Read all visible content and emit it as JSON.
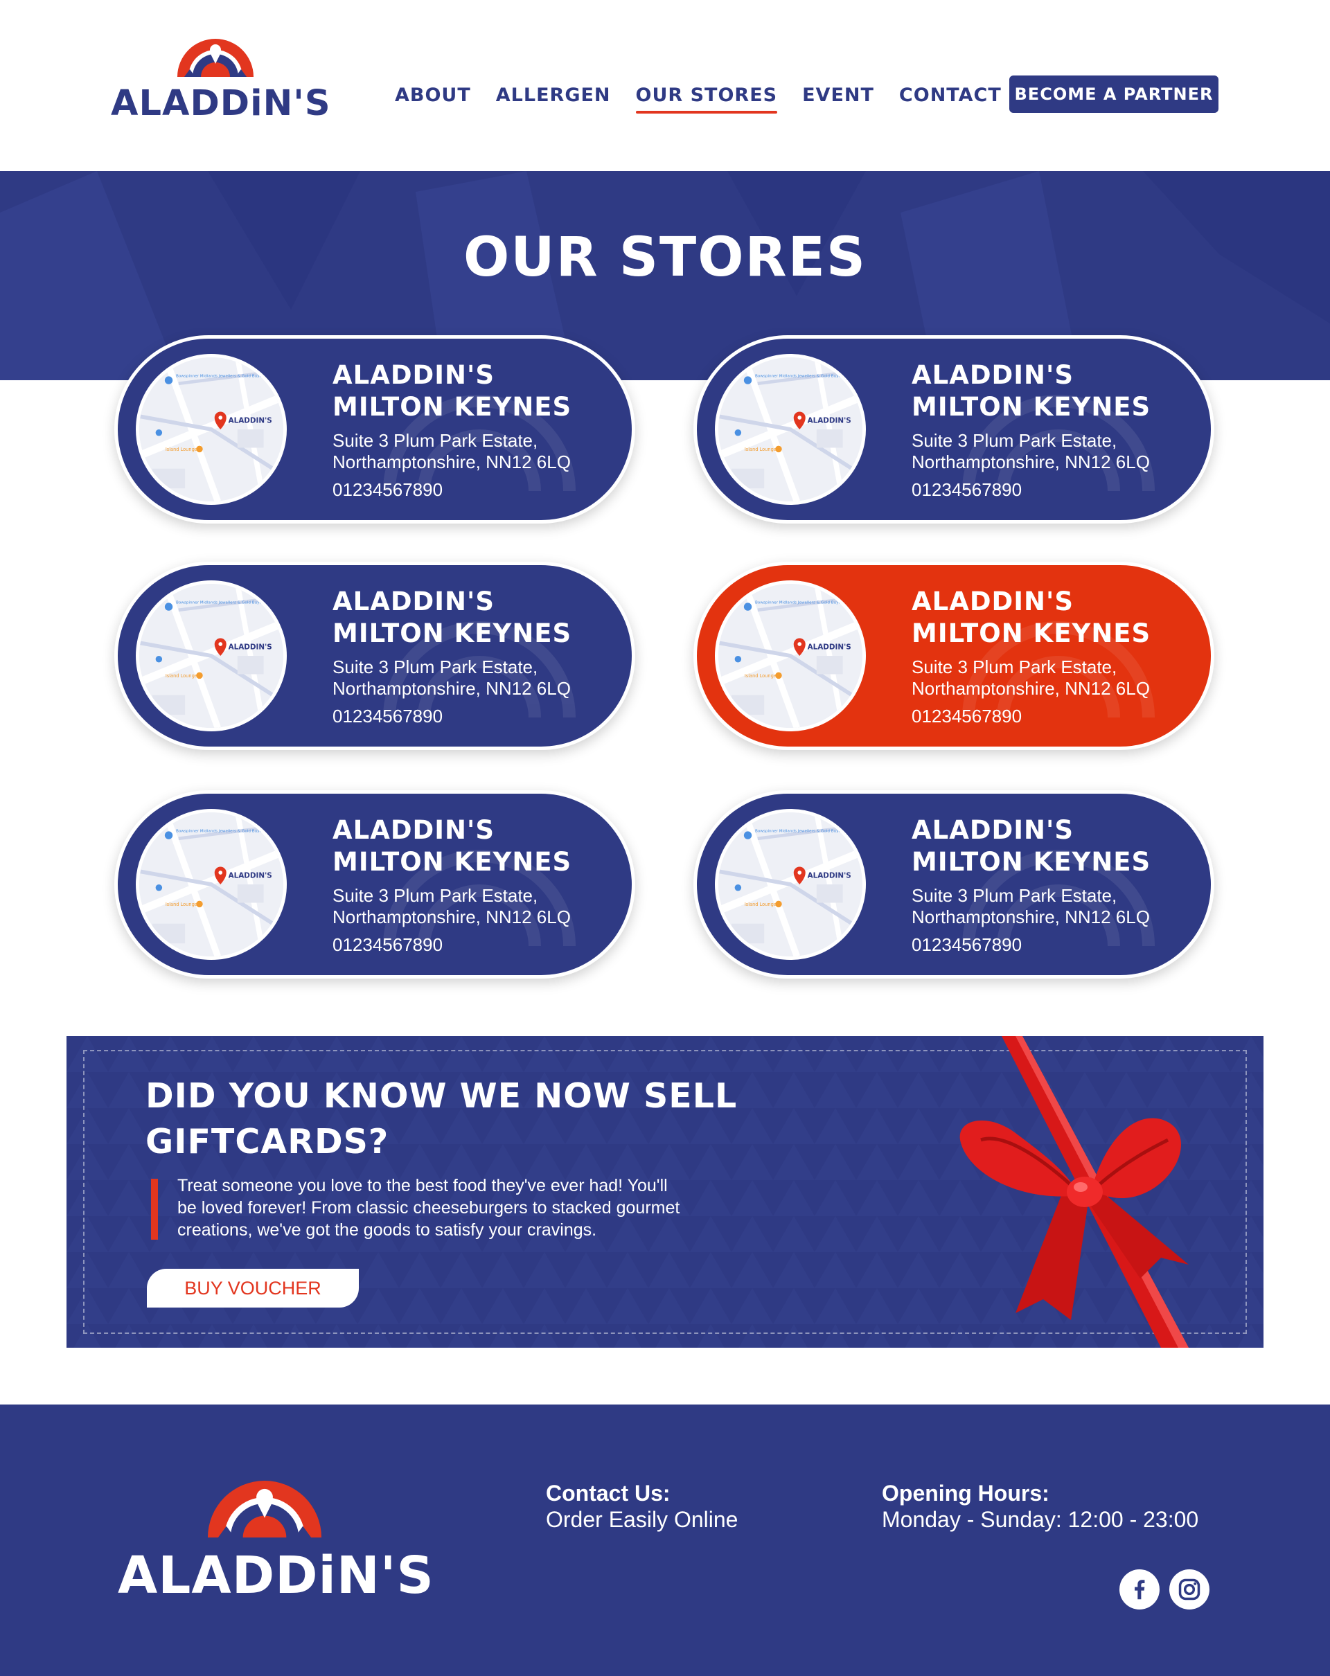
{
  "brand": {
    "name": "ALADDiN'S"
  },
  "nav": {
    "items": [
      "ABOUT",
      "ALLERGEN",
      "OUR STORES",
      "EVENT",
      "CONTACT US"
    ],
    "active": "OUR STORES",
    "cta": "BECOME A PARTNER"
  },
  "hero": {
    "title": "OUR STORES"
  },
  "stores": [
    {
      "name_line1": "ALADDIN'S",
      "name_line2": "MILTON KEYNES",
      "address_line1": "Suite 3 Plum Park Estate,",
      "address_line2": "Northamptonshire, NN12 6LQ",
      "phone": "01234567890",
      "map_label": "ALADDIN'S",
      "map_place1": "Bowspinner Midlands Jewellers & Gold Buyers",
      "map_place2": "Island Lounge",
      "highlighted": false
    },
    {
      "name_line1": "ALADDIN'S",
      "name_line2": "MILTON KEYNES",
      "address_line1": "Suite 3 Plum Park Estate,",
      "address_line2": "Northamptonshire, NN12 6LQ",
      "phone": "01234567890",
      "map_label": "ALADDIN'S",
      "map_place1": "Bowspinner Midlands Jewellers & Gold Buyers",
      "map_place2": "Island Lounge",
      "highlighted": false
    },
    {
      "name_line1": "ALADDIN'S",
      "name_line2": "MILTON KEYNES",
      "address_line1": "Suite 3 Plum Park Estate,",
      "address_line2": "Northamptonshire, NN12 6LQ",
      "phone": "01234567890",
      "map_label": "ALADDIN'S",
      "map_place1": "Bowspinner Midlands Jewellers & Gold Buyers",
      "map_place2": "Island Lounge",
      "highlighted": false
    },
    {
      "name_line1": "ALADDIN'S",
      "name_line2": "MILTON KEYNES",
      "address_line1": "Suite 3 Plum Park Estate,",
      "address_line2": "Northamptonshire, NN12 6LQ",
      "phone": "01234567890",
      "map_label": "ALADDIN'S",
      "map_place1": "Bowspinner Midlands Jewellers & Gold Buyers",
      "map_place2": "Island Lounge",
      "highlighted": true
    },
    {
      "name_line1": "ALADDIN'S",
      "name_line2": "MILTON KEYNES",
      "address_line1": "Suite 3 Plum Park Estate,",
      "address_line2": "Northamptonshire, NN12 6LQ",
      "phone": "01234567890",
      "map_label": "ALADDIN'S",
      "map_place1": "Bowspinner Midlands Jewellers & Gold Buyers",
      "map_place2": "Island Lounge",
      "highlighted": false
    },
    {
      "name_line1": "ALADDIN'S",
      "name_line2": "MILTON KEYNES",
      "address_line1": "Suite 3 Plum Park Estate,",
      "address_line2": "Northamptonshire, NN12 6LQ",
      "phone": "01234567890",
      "map_label": "ALADDIN'S",
      "map_place1": "Bowspinner Midlands Jewellers & Gold Buyers",
      "map_place2": "Island Lounge",
      "highlighted": false
    }
  ],
  "giftcard": {
    "title_line1": "DID YOU KNOW WE NOW SELL",
    "title_line2": "GIFTCARDS?",
    "body_line1": "Treat someone you love to the best food they've ever had! You'll",
    "body_line2": "be loved forever! From classic cheeseburgers to stacked gourmet",
    "body_line3": "creations, we've got the goods to satisfy your cravings.",
    "button": "BUY VOUCHER"
  },
  "footer": {
    "contact_heading": "Contact Us:",
    "contact_text": "Order Easily Online",
    "hours_heading": "Opening Hours:",
    "hours_text": "Monday - Sunday: 12:00 - 23:00",
    "social": [
      "facebook-icon",
      "instagram-icon"
    ]
  },
  "colors": {
    "primary": "#2f3a84",
    "accent": "#e2361f",
    "highlight_card": "#e3330f",
    "white": "#ffffff"
  }
}
